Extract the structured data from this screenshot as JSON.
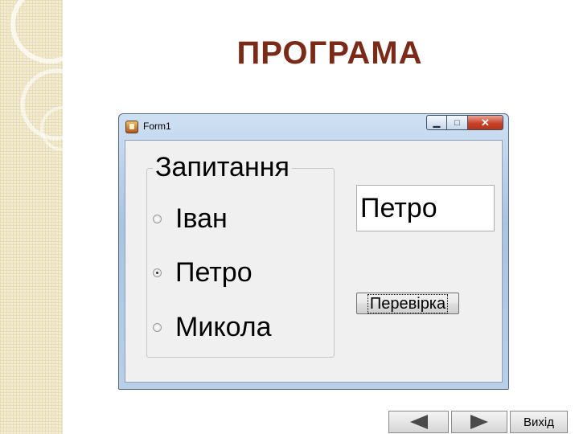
{
  "slide": {
    "title": "ПРОГРАМА"
  },
  "window": {
    "title": "Form1",
    "title_buttons": {
      "minimize": "▁",
      "maximize": "□",
      "close": "✕"
    }
  },
  "form": {
    "group_title": "Запитання",
    "options": [
      {
        "label": "Іван",
        "checked": false
      },
      {
        "label": "Петро",
        "checked": true
      },
      {
        "label": "Микола",
        "checked": false
      }
    ],
    "answer_text": "Петро",
    "check_button": "Перевірка"
  },
  "nav": {
    "prev_icon": "triangle-left-icon",
    "next_icon": "triangle-right-icon",
    "exit_label": "Вихід"
  },
  "colors": {
    "title": "#7a2a17",
    "nav_arrow": "#4a4a4a",
    "deco_background": "#f3ecd3"
  }
}
